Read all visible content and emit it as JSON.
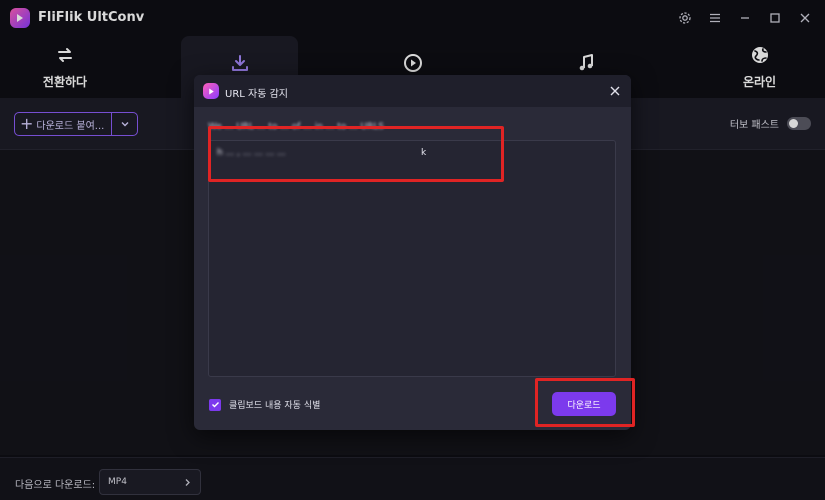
{
  "app": {
    "title": "FliFlik UltConv"
  },
  "nav": {
    "tabs": [
      {
        "label": "전환하다",
        "icon": "convert-arrows-icon"
      },
      {
        "label": "",
        "icon": "download-icon",
        "active": true
      },
      {
        "label": "",
        "icon": "play-icon"
      },
      {
        "label": "",
        "icon": "music-note-icon"
      },
      {
        "label": "온라인",
        "icon": "globe-icon"
      }
    ]
  },
  "toolbar": {
    "paste_label": "다운로드 붙여...",
    "turbo_label": "터보 패스트",
    "turbo_on": false
  },
  "dialog": {
    "title": "URL 자동 감지",
    "hint": "We ... URL ... to ... of ... in ... to ... URLS",
    "url_value_blurred": "h  ...  ,  ...  ...  ...  ...",
    "url_value_end": "k",
    "checkbox_label": "클립보드 내용 자동 식별",
    "checkbox_checked": true,
    "download_button": "다운로드"
  },
  "bottombar": {
    "download_as_label": "다음으로 다운로드:",
    "format_value": "MP4"
  },
  "colors": {
    "accent": "#7c3aed",
    "accent_border": "#8b5cf6",
    "highlight": "#e02424",
    "background": "#0f0f14"
  }
}
